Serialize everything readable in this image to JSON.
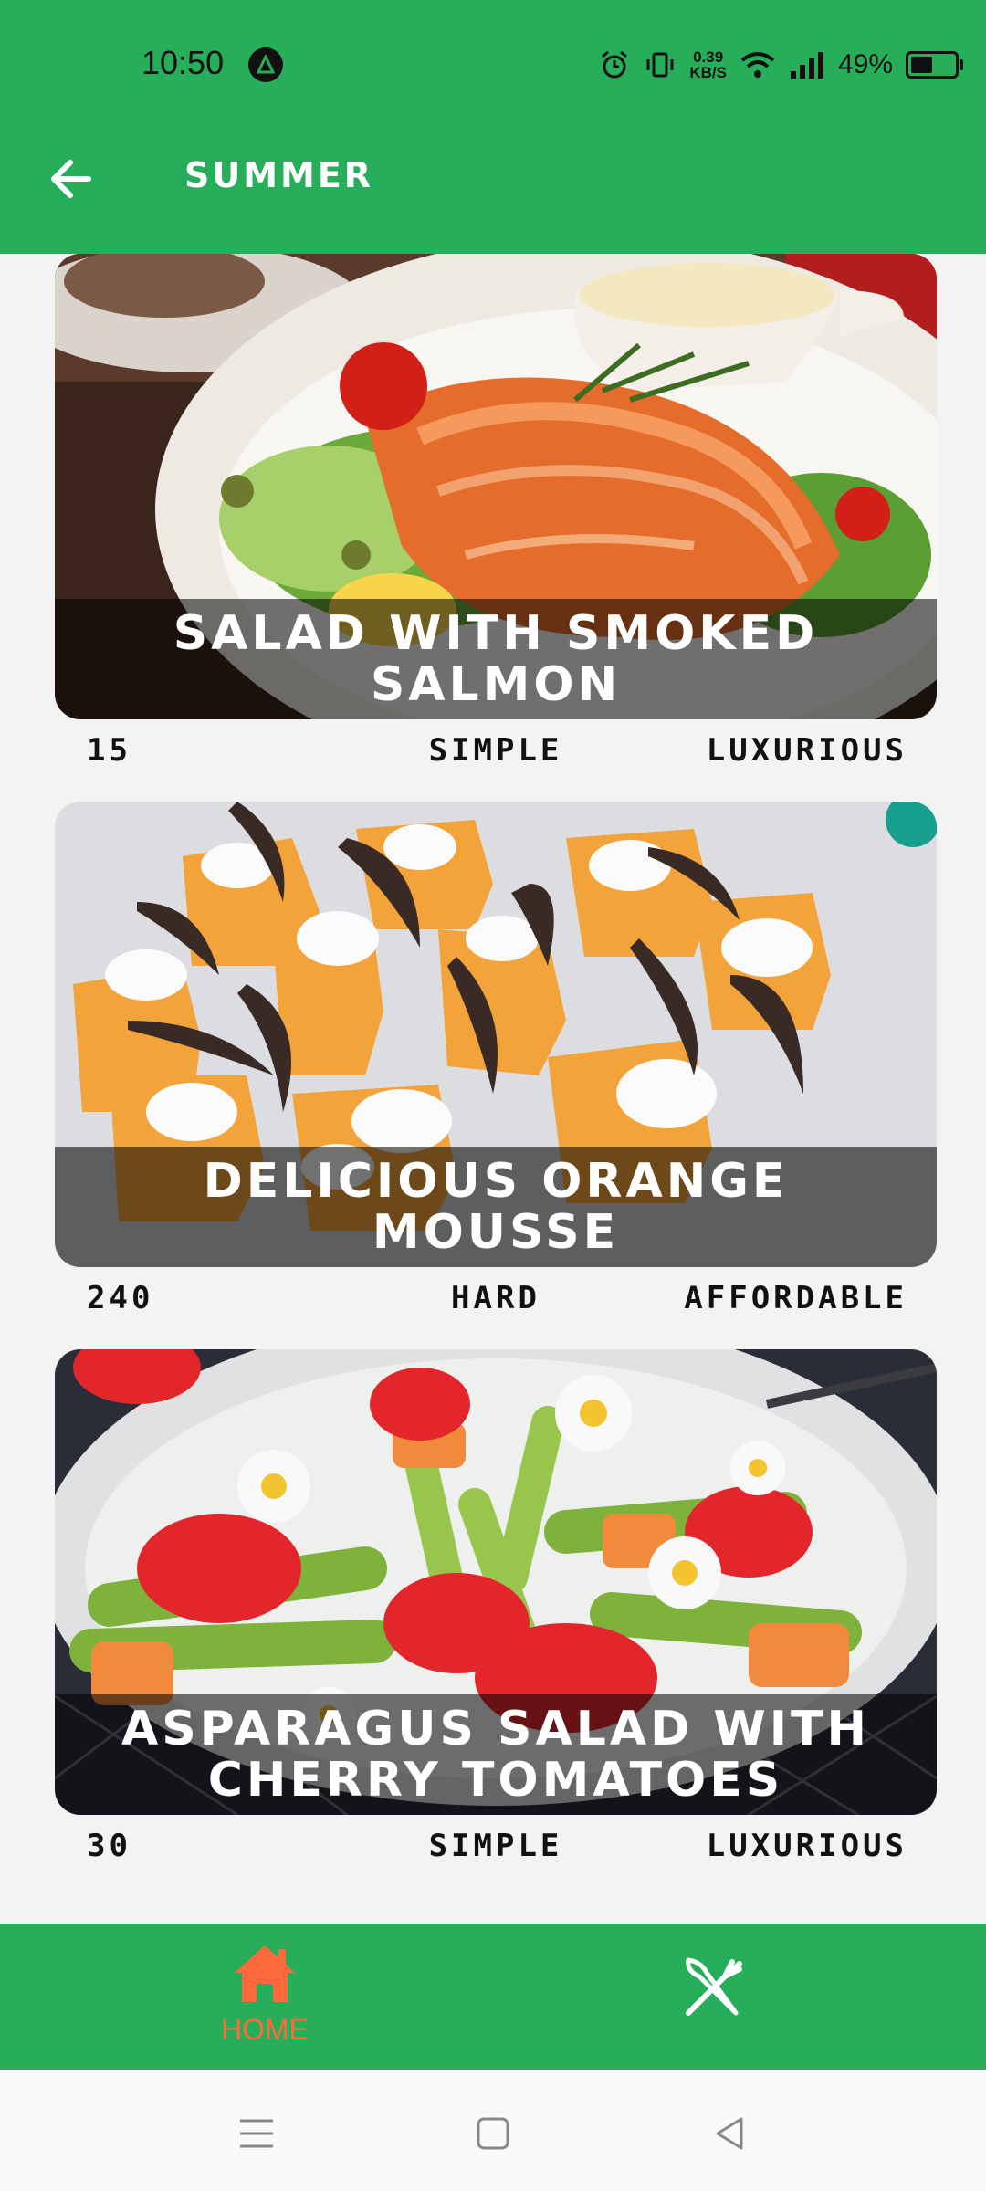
{
  "status": {
    "time": "10:50",
    "net_speed_value": "0.39",
    "net_speed_unit": "KB/S",
    "battery_percent": "49%",
    "battery_level": 0.49
  },
  "app_bar": {
    "title": "SUMMER",
    "back_icon": "arrow-left-icon"
  },
  "meals": [
    {
      "title": "SALAD WITH SMOKED SALMON",
      "duration": "15",
      "complexity": "SIMPLE",
      "affordability": "LUXURIOUS"
    },
    {
      "title": "DELICIOUS ORANGE MOUSSE",
      "duration": "240",
      "complexity": "HARD",
      "affordability": "AFFORDABLE"
    },
    {
      "title": "ASPARAGUS SALAD WITH CHERRY TOMATOES",
      "duration": "30",
      "complexity": "SIMPLE",
      "affordability": "LUXURIOUS"
    }
  ],
  "bottom_nav": {
    "items": [
      {
        "label": "HOME",
        "icon": "home-icon",
        "active": true,
        "color": "#ff6a3d"
      },
      {
        "label": "",
        "icon": "cutlery-icon",
        "active": false
      }
    ]
  },
  "colors": {
    "primary": "#27ae5a",
    "accent": "#ff6a3d"
  }
}
